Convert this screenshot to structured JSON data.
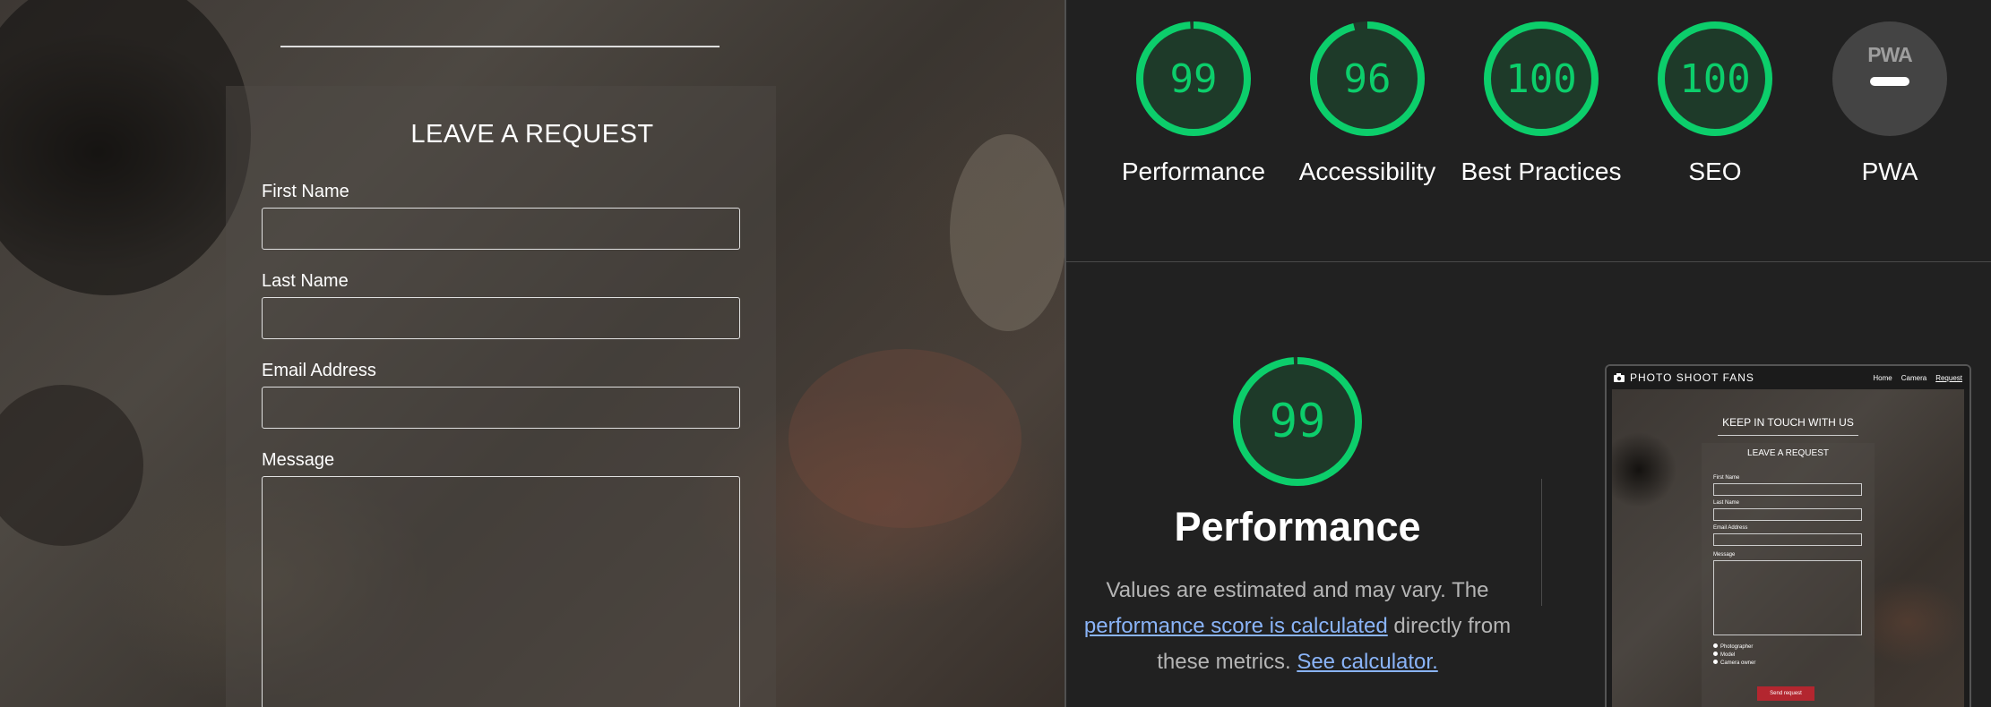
{
  "form": {
    "title": "LEAVE A REQUEST",
    "fields": [
      {
        "label": "First Name",
        "value": ""
      },
      {
        "label": "Last Name",
        "value": ""
      },
      {
        "label": "Email Address",
        "value": ""
      },
      {
        "label": "Message",
        "value": ""
      }
    ]
  },
  "lighthouse": {
    "scores": [
      {
        "label": "Performance",
        "value": "99",
        "fraction": 0.99
      },
      {
        "label": "Accessibility",
        "value": "96",
        "fraction": 0.96
      },
      {
        "label": "Best Practices",
        "value": "100",
        "fraction": 1.0
      },
      {
        "label": "SEO",
        "value": "100",
        "fraction": 1.0
      }
    ],
    "pwa": {
      "badge_text": "PWA",
      "label": "PWA"
    },
    "detail": {
      "score": "99",
      "fraction": 0.99,
      "title": "Performance",
      "desc_prefix": "Values are estimated and may vary. The",
      "link_text": "performance score is calculated",
      "desc_middle": "directly from these metrics.",
      "calculator_link": "See calculator."
    },
    "colors": {
      "pass": "#0cce6b",
      "background": "#212121",
      "link": "#8ab4f8"
    }
  },
  "thumbnail": {
    "brand": "PHOTO SHOOT FANS",
    "camera_icon": "camera-icon",
    "nav": [
      "Home",
      "Camera",
      "Request"
    ],
    "heading": "KEEP IN TOUCH WITH US",
    "form_title": "LEAVE A REQUEST",
    "field_labels": [
      "First Name",
      "Last Name",
      "Email Address",
      "Message"
    ],
    "radio_options": [
      "Photographer",
      "Model",
      "Camera owner"
    ],
    "submit_label": "Send request"
  }
}
